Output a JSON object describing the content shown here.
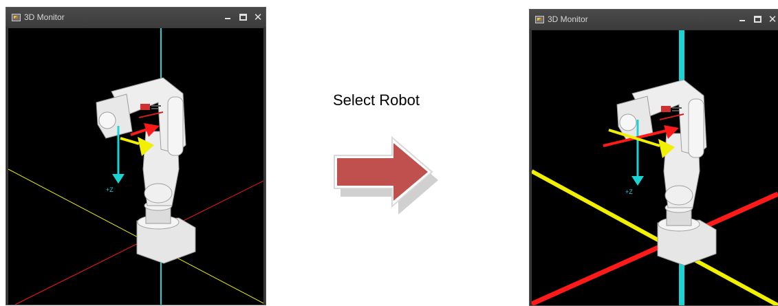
{
  "left_window": {
    "title": "3D Monitor",
    "icon": "monitor-app-icon",
    "controls": [
      "minimize-icon",
      "maximize-icon",
      "close-icon"
    ],
    "close_glyph": "✕",
    "axis_label": "+Z",
    "highlighted": false
  },
  "right_window": {
    "title": "3D Monitor",
    "icon": "monitor-app-icon",
    "controls": [
      "minimize-icon",
      "maximize-icon",
      "close-icon"
    ],
    "close_glyph": "✕",
    "axis_label": "+Z",
    "highlighted": true
  },
  "transition": {
    "label": "Select Robot",
    "arrow_color": "#c0504d",
    "arrow_icon": "right-arrow-icon"
  },
  "colors": {
    "x_axis": "#ff1a1a",
    "y_axis": "#f0f000",
    "z_axis": "#1ad4d4",
    "background": "#000000"
  }
}
